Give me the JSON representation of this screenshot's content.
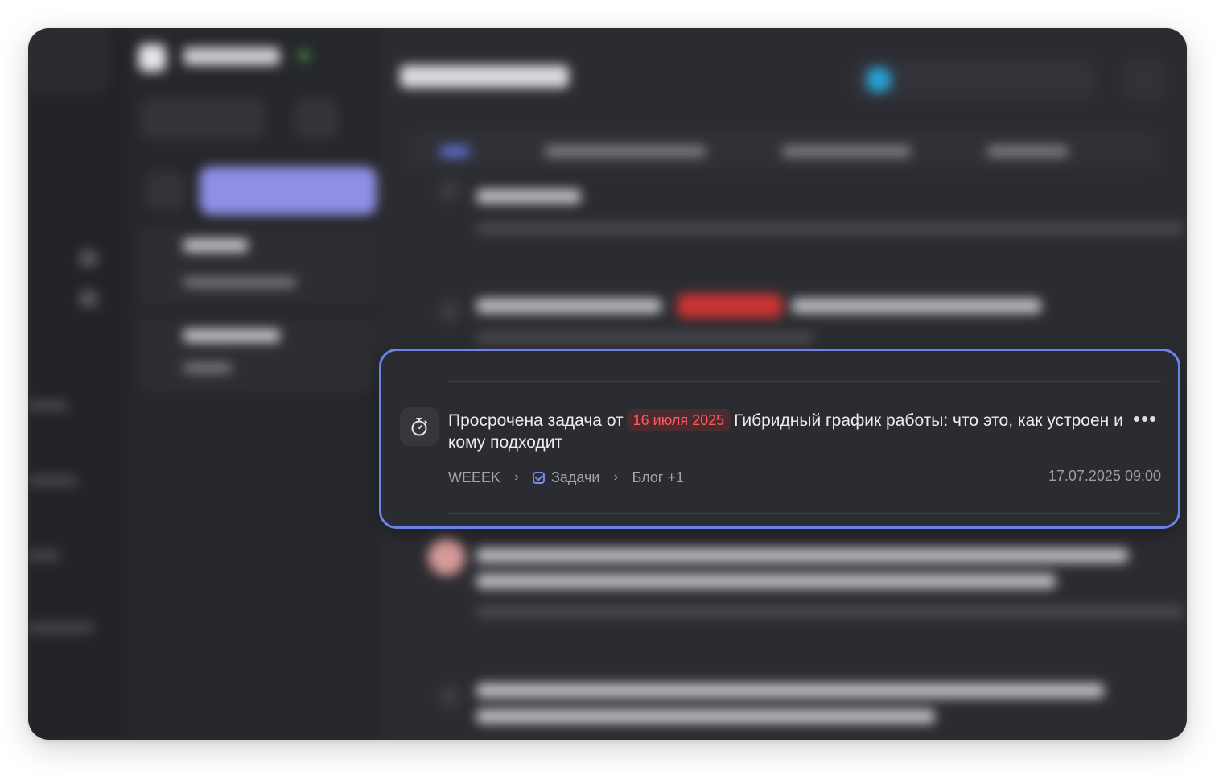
{
  "notification": {
    "title_prefix": "Просрочена задача от",
    "date": "16 июля 2025",
    "title_text": "Гибридный график работы: что это, как устроен и кому подходит",
    "more": "•••",
    "breadcrumb": [
      "WEEEK",
      "Задачи",
      "Блог +1"
    ],
    "timestamp": "17.07.2025 09:00",
    "icon": "stopwatch-icon"
  },
  "colors": {
    "accent": "#6a83e8",
    "badge_text": "#ff5a5f",
    "badge_bg": "#4a2b2f"
  }
}
